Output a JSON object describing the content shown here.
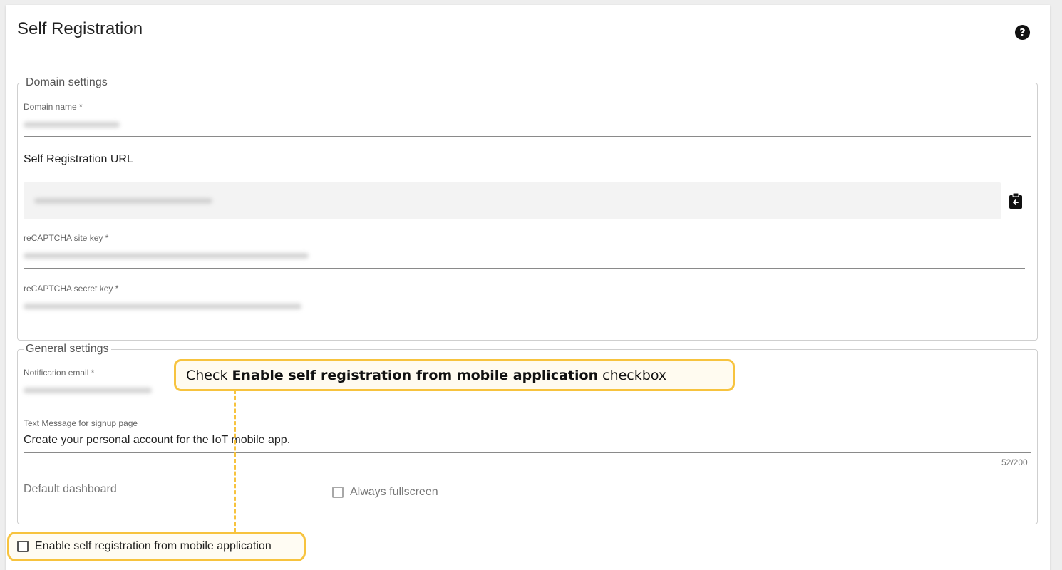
{
  "page": {
    "title": "Self Registration"
  },
  "domain_settings": {
    "legend": "Domain settings",
    "domain_name_label": "Domain name *",
    "self_registration_url_label": "Self Registration URL",
    "recaptcha_site_key_label": "reCAPTCHA site key *",
    "recaptcha_secret_key_label": "reCAPTCHA secret key *"
  },
  "general_settings": {
    "legend": "General settings",
    "notification_email_label": "Notification email *",
    "signup_text_label": "Text Message for signup page",
    "signup_text_value": "Create your personal account for the IoT mobile app.",
    "signup_text_counter": "52/200",
    "default_dashboard_placeholder": "Default dashboard",
    "always_fullscreen_label": "Always fullscreen"
  },
  "mobile": {
    "enable_label": "Enable self registration from mobile application"
  },
  "callout": {
    "prefix": "Check",
    "bold": "Enable self registration from mobile application",
    "suffix": "checkbox"
  },
  "colors": {
    "highlight": "#f7c33e",
    "card": "#ffffff",
    "page_bg": "#eeeeee"
  },
  "icons": {
    "help": "help-circle-icon",
    "copy": "clipboard-copy-icon"
  }
}
